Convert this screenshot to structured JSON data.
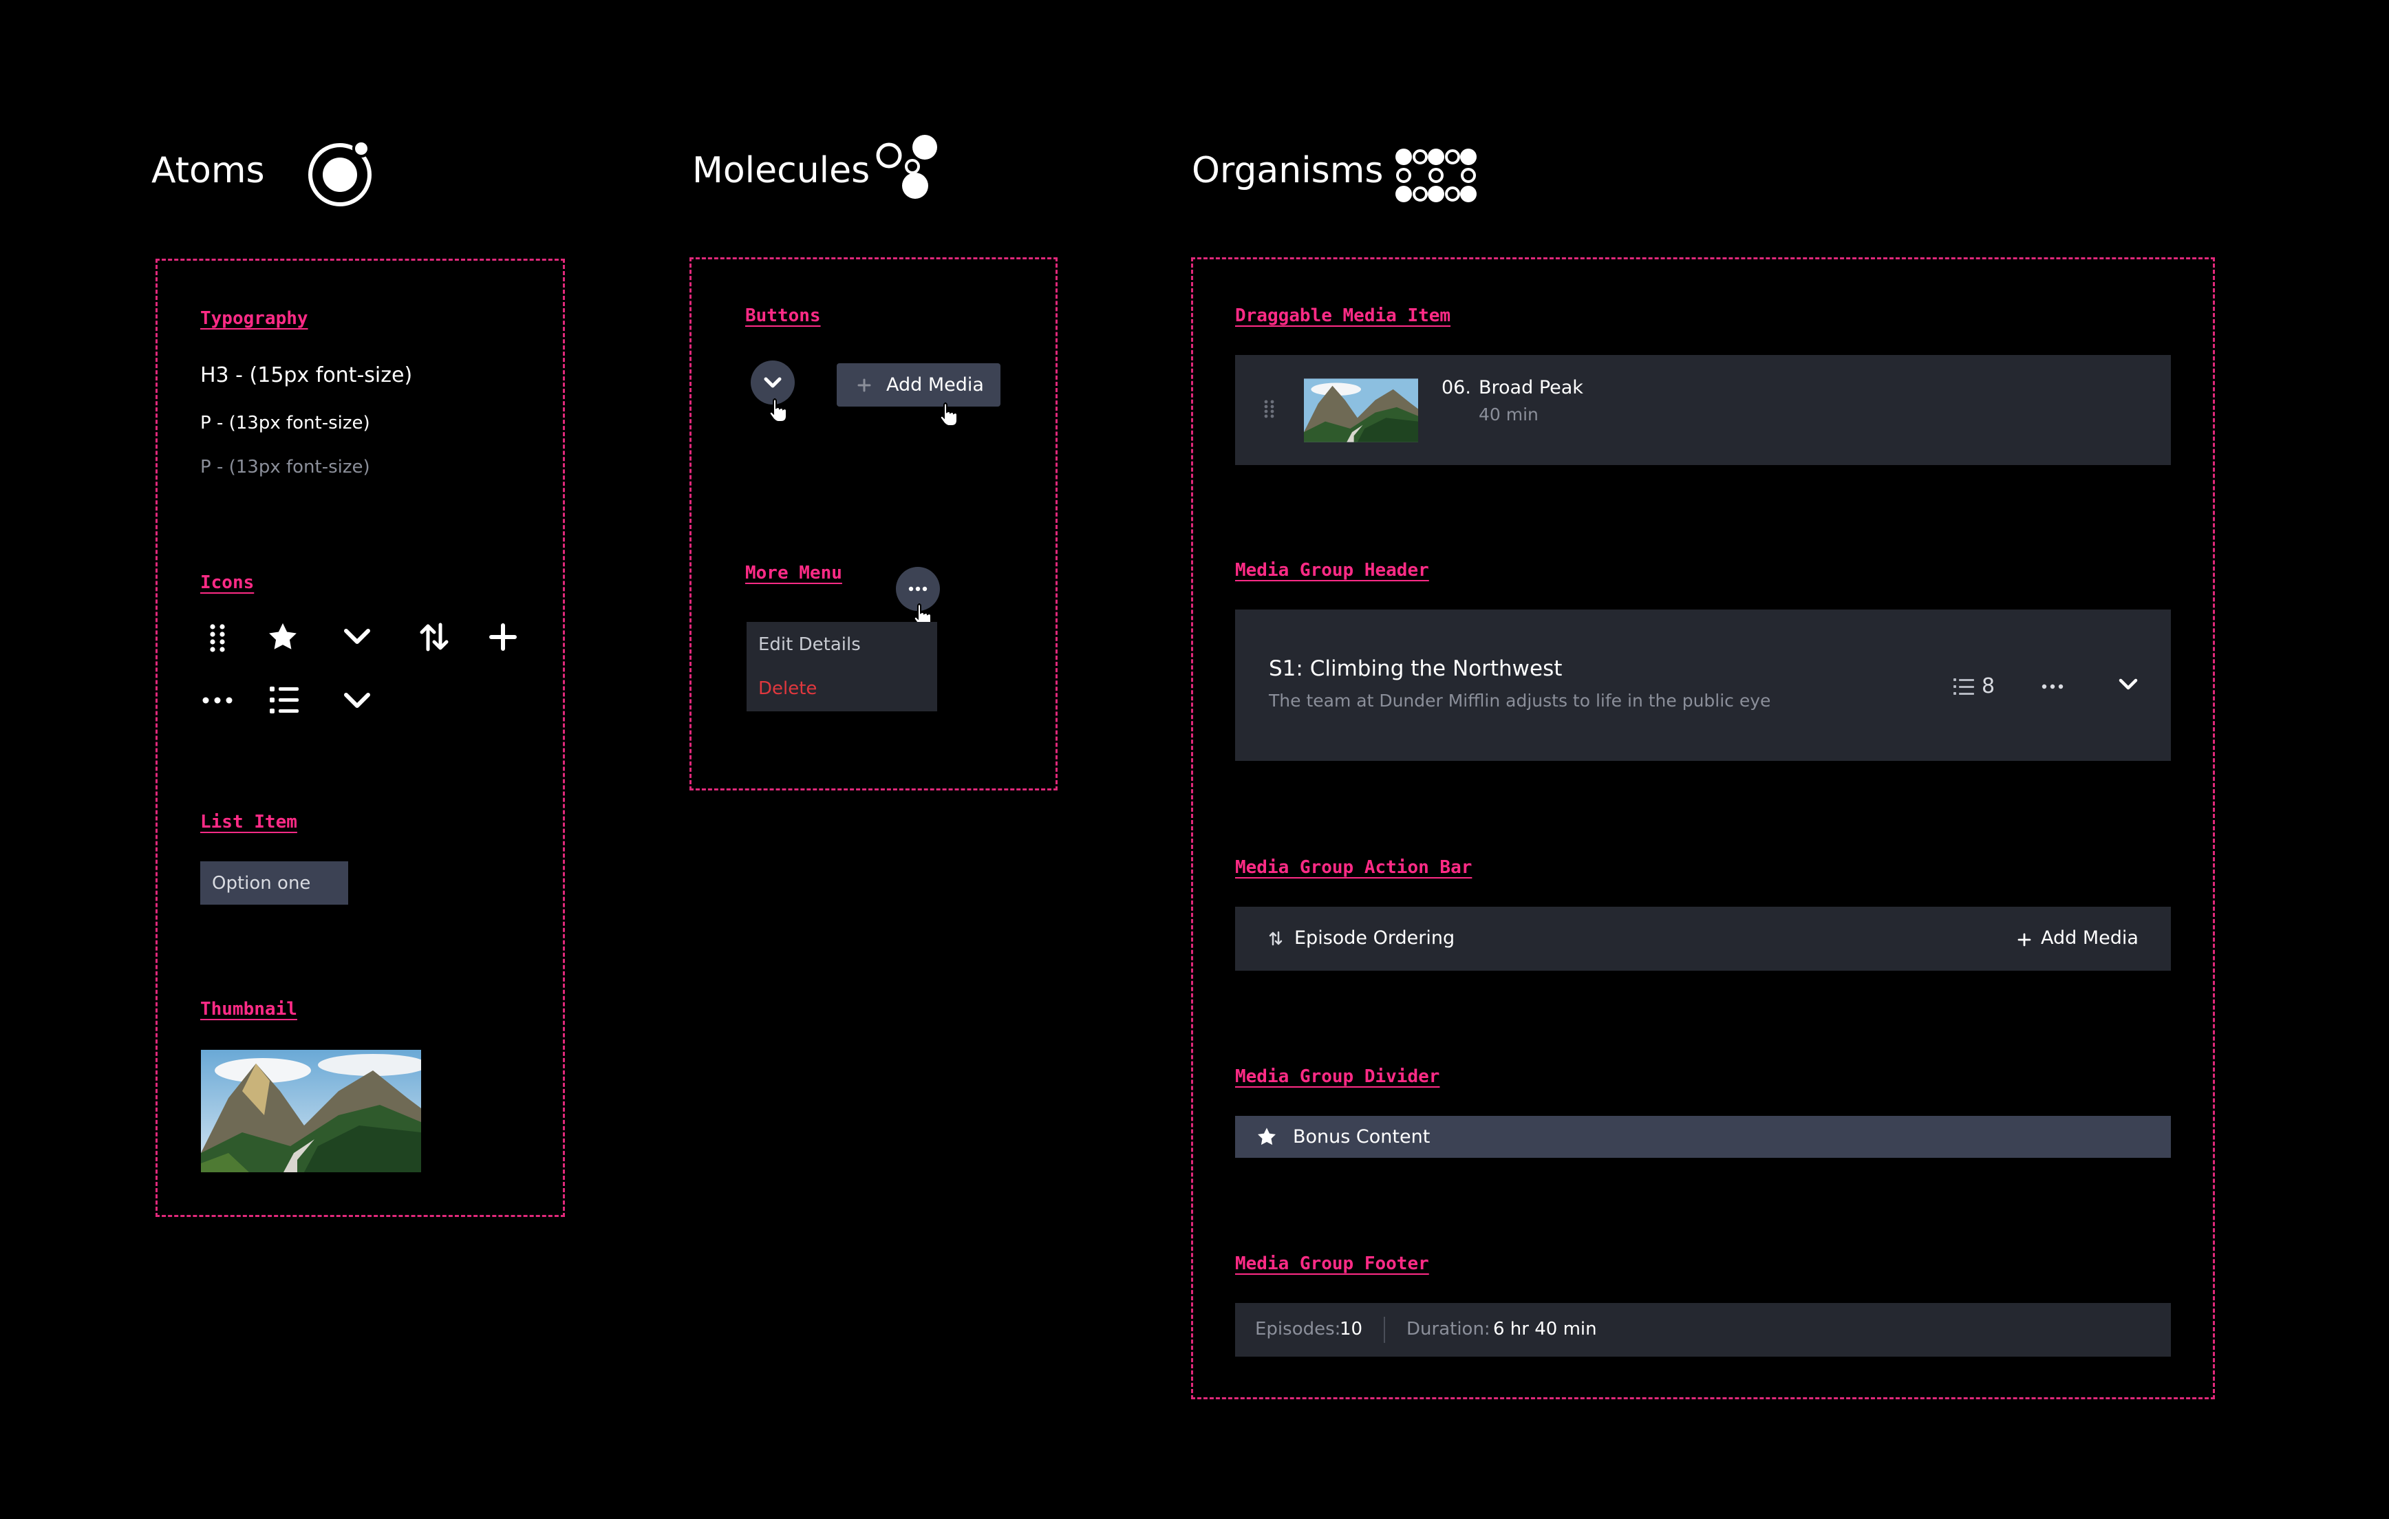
{
  "columns": {
    "atoms": "Atoms",
    "molecules": "Molecules",
    "organisms": "Organisms"
  },
  "atoms": {
    "typography_label": "Typography",
    "h3_sample": "H3 -  (15px font-size)",
    "p_sample": "P -  (13px font-size)",
    "p_muted_sample": "P - (13px font-size)",
    "icons_label": "Icons",
    "icons": [
      "drag-handle-icon",
      "star-icon",
      "chevron-down-icon",
      "sort-icon",
      "plus-icon",
      "more-icon",
      "list-icon",
      "chevron-down-icon"
    ],
    "list_item_label": "List Item",
    "list_item_value": "Option one",
    "thumbnail_label": "Thumbnail"
  },
  "molecules": {
    "buttons_label": "Buttons",
    "add_media_button": "Add Media",
    "more_menu_label": "More Menu",
    "menu_items": [
      "Edit Details",
      "Delete"
    ]
  },
  "organisms": {
    "draggable_label": "Draggable Media Item",
    "media_item": {
      "number": "06.",
      "title": "Broad Peak",
      "duration": "40 min"
    },
    "group_header_label": "Media Group Header",
    "group_header": {
      "title": "S1: Climbing the Northwest",
      "description": "The team at Dunder Mifflin adjusts to life in the public eye",
      "count": "8"
    },
    "action_bar_label": "Media Group Action Bar",
    "action_bar": {
      "ordering": "Episode Ordering",
      "add_media": "Add Media"
    },
    "divider_label": "Media Group Divider",
    "divider": {
      "title": "Bonus Content"
    },
    "footer_label": "Media Group Footer",
    "footer": {
      "episodes_label": "Episodes:",
      "episodes_value": "10",
      "duration_label": "Duration:",
      "duration_value": "6 hr 40 min"
    }
  },
  "colors": {
    "accent": "#ff2b86",
    "panel": "#252830",
    "button": "#3d4354",
    "danger": "#e0383e",
    "muted_text": "#8b8f9a"
  }
}
